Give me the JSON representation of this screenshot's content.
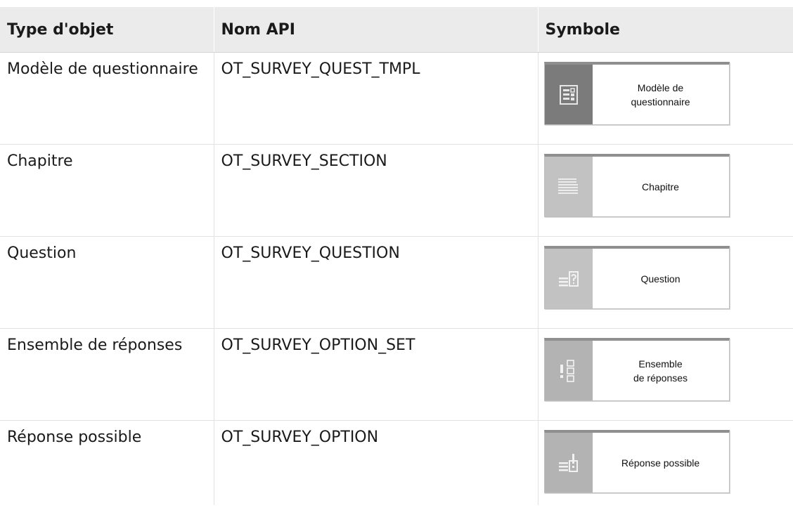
{
  "header": {
    "type_label": "Type d'objet",
    "api_label": "Nom API",
    "symbol_label": "Symbole"
  },
  "rows": [
    {
      "type": "Modèle de questionnaire",
      "api": "OT_SURVEY_QUEST_TMPL",
      "symbol_text": "Modèle de\nquestionnaire",
      "icon": "questionnaire-template-icon"
    },
    {
      "type": "Chapitre",
      "api": "OT_SURVEY_SECTION",
      "symbol_text": "Chapitre",
      "icon": "chapter-lines-icon"
    },
    {
      "type": "Question",
      "api": "OT_SURVEY_QUESTION",
      "symbol_text": "Question",
      "icon": "question-icon"
    },
    {
      "type": "Ensemble de réponses",
      "api": "OT_SURVEY_OPTION_SET",
      "symbol_text": "Ensemble\nde réponses",
      "icon": "option-set-icon"
    },
    {
      "type": "Réponse possible",
      "api": "OT_SURVEY_OPTION",
      "symbol_text": "Réponse possible",
      "icon": "option-icon"
    }
  ],
  "colors": {
    "header_bg": "#ebebeb",
    "symbol_tab_dark": "#7b7b7b",
    "symbol_tab_light": "#c2c2c2"
  }
}
